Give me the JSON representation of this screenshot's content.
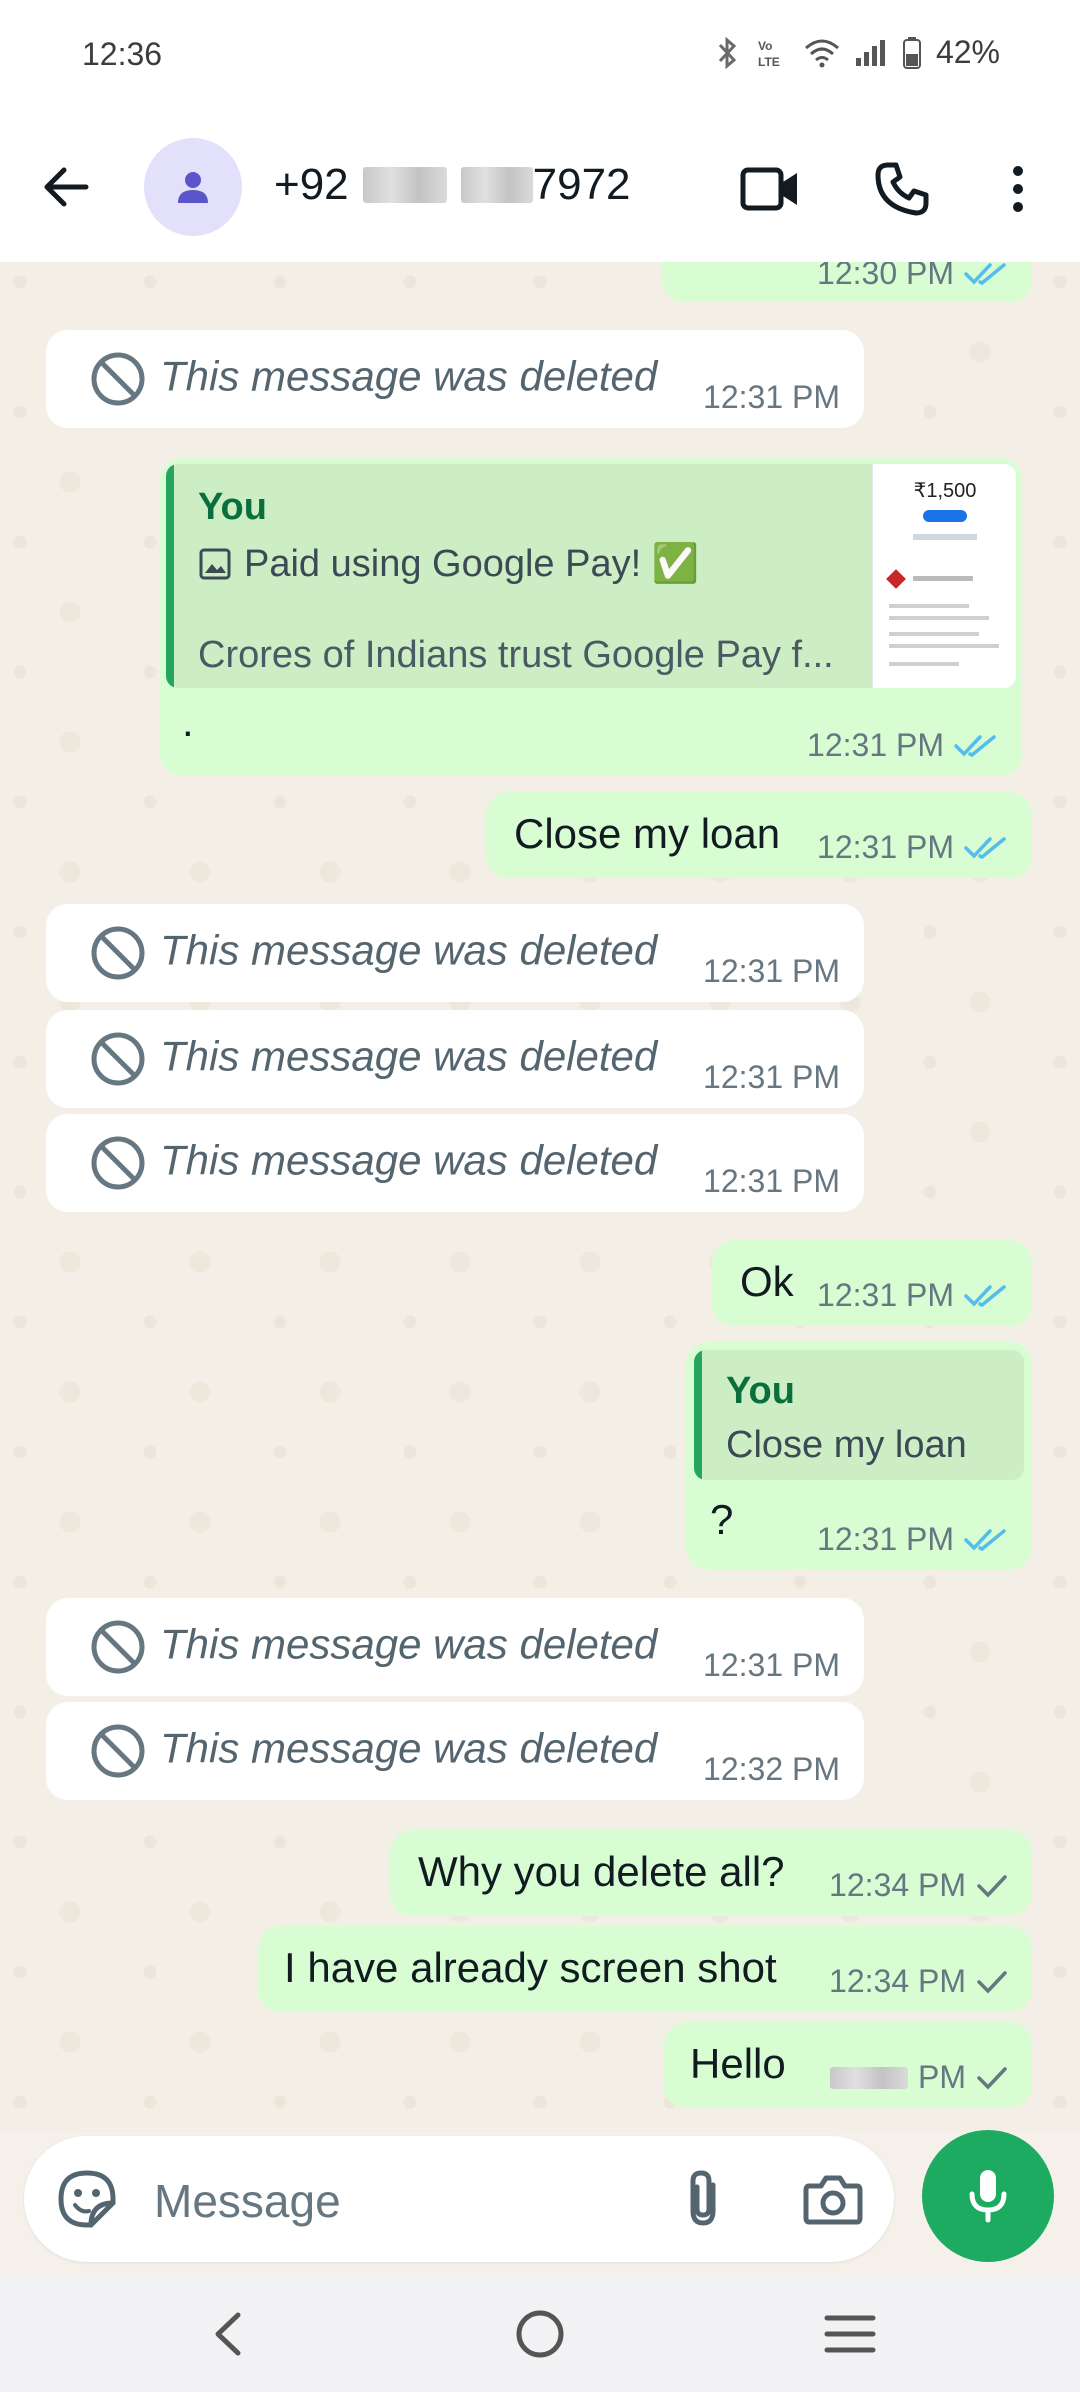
{
  "status_bar": {
    "time": "12:36",
    "battery": "42%"
  },
  "header": {
    "prefix": "+92",
    "suffix": "7972"
  },
  "messages": [
    {
      "ts": "12:30 PM"
    },
    {
      "text": "This message was deleted",
      "ts": "12:31 PM"
    },
    {
      "quote_name": "You",
      "quote_line1": "Paid using Google Pay! ✅",
      "quote_line2": "Crores of Indians trust Google Pay f...",
      "body": ".",
      "ts": "12:31 PM",
      "thumb_amount": "₹1,500"
    },
    {
      "text": "Close my loan",
      "ts": "12:31 PM"
    },
    {
      "text": "This message was deleted",
      "ts": "12:31 PM"
    },
    {
      "text": "This message was deleted",
      "ts": "12:31 PM"
    },
    {
      "text": "This message was deleted",
      "ts": "12:31 PM"
    },
    {
      "text": "Ok",
      "ts": "12:31 PM"
    },
    {
      "quote_name": "You",
      "quote_line1": "Close my loan",
      "body": "?",
      "ts": "12:31 PM"
    },
    {
      "text": "This message was deleted",
      "ts": "12:31 PM"
    },
    {
      "text": "This message was deleted",
      "ts": "12:32 PM"
    },
    {
      "text": "Why you delete all?",
      "ts": "12:34 PM"
    },
    {
      "text": "I have already screen shot",
      "ts": "12:34 PM"
    },
    {
      "text": "Hello",
      "ts_suffix": "PM"
    }
  ],
  "composer": {
    "placeholder": "Message"
  },
  "colors": {
    "outgoing": "#d9fdd3",
    "incoming": "#ffffff",
    "read_ticks": "#53bdeb",
    "sent_tick": "#667781",
    "accent": "#1daa61"
  },
  "icons": [
    "back-arrow-icon",
    "person-icon",
    "video-call-icon",
    "phone-icon",
    "more-vert-icon",
    "ban-icon",
    "double-check-icon",
    "check-icon",
    "sticker-icon",
    "attach-icon",
    "camera-icon",
    "mic-icon"
  ]
}
